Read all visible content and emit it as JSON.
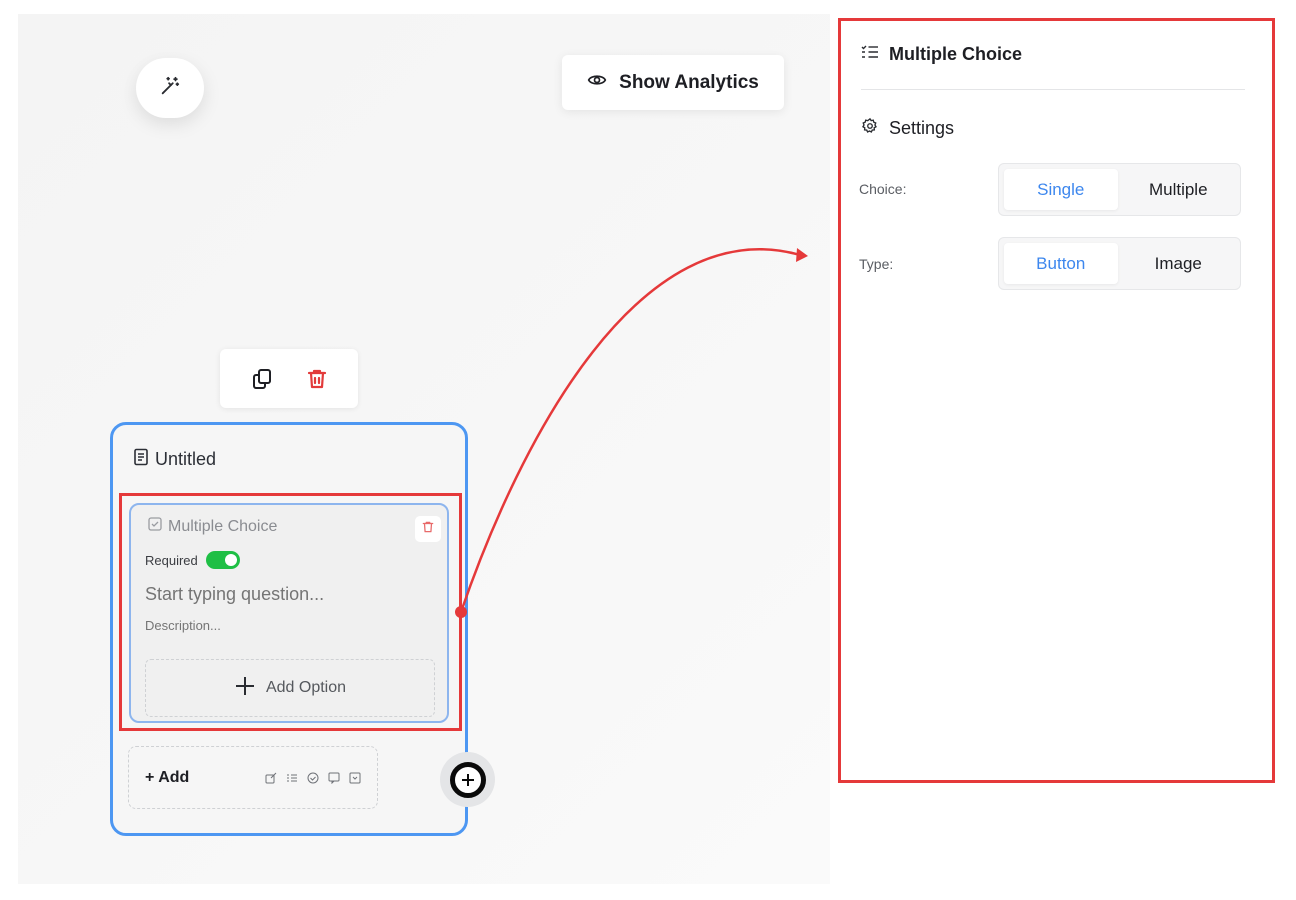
{
  "toolbar": {
    "analytics_label": "Show Analytics"
  },
  "node": {
    "title": "Untitled",
    "block": {
      "type_label": "Multiple Choice",
      "required_label": "Required",
      "required": true,
      "question_placeholder": "Start typing question...",
      "description_placeholder": "Description...",
      "add_option_label": "Add Option"
    },
    "add_label": "+ Add",
    "add_icons": [
      "text-edit-icon",
      "list-icon",
      "check-circle-icon",
      "message-icon",
      "dropdown-icon"
    ]
  },
  "panel": {
    "title": "Multiple Choice",
    "settings_label": "Settings",
    "choice": {
      "label": "Choice:",
      "options": [
        "Single",
        "Multiple"
      ],
      "selected": "Single"
    },
    "type": {
      "label": "Type:",
      "options": [
        "Button",
        "Image"
      ],
      "selected": "Button"
    }
  },
  "colors": {
    "accent_blue": "#3d87ee",
    "card_border": "#4d97f2",
    "highlight_red": "#e5393a",
    "toggle_green": "#1fbf45",
    "delete_red": "#e23b3b"
  }
}
